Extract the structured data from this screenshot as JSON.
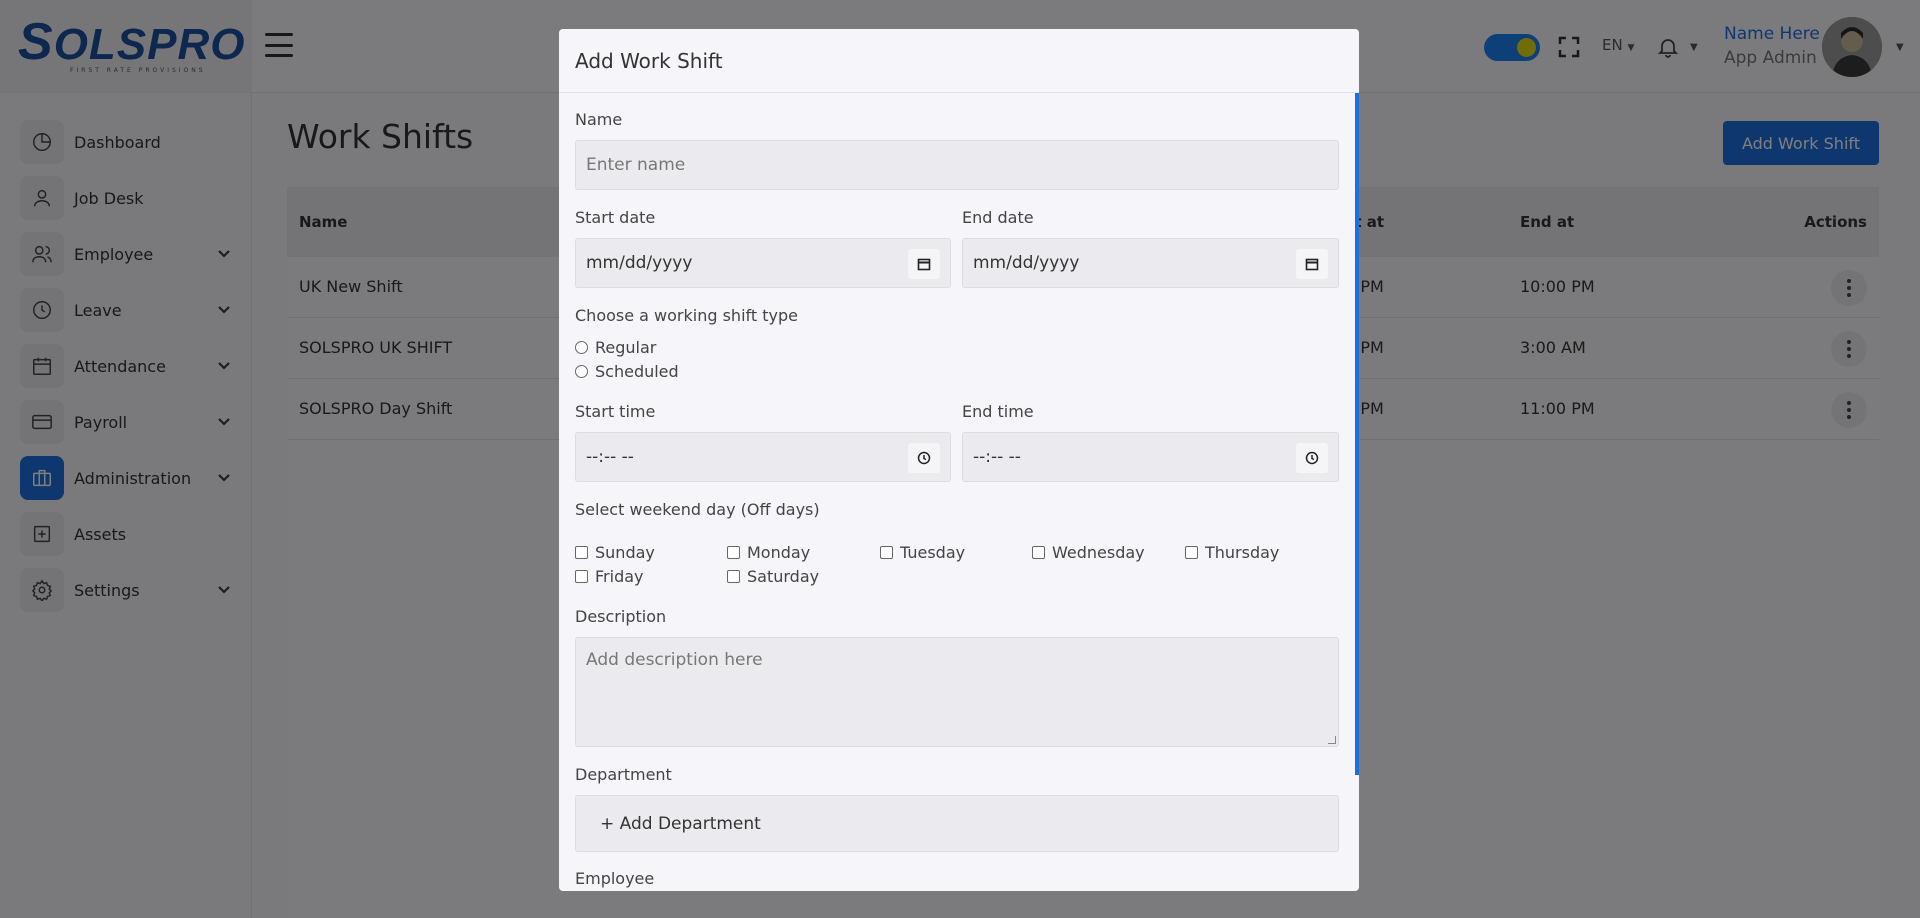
{
  "header": {
    "logo_text": "OLSPRO",
    "logo_tagline": "FIRST RATE PROVISIONS",
    "language": "EN",
    "user_name": "Name Here",
    "user_role": "App Admin"
  },
  "sidebar": {
    "items": [
      {
        "label": "Dashboard",
        "icon": "dashboard-icon",
        "chevron": false,
        "active": false
      },
      {
        "label": "Job Desk",
        "icon": "user-icon",
        "chevron": false,
        "active": false
      },
      {
        "label": "Employee",
        "icon": "users-icon",
        "chevron": true,
        "active": false
      },
      {
        "label": "Leave",
        "icon": "clock-icon",
        "chevron": true,
        "active": false
      },
      {
        "label": "Attendance",
        "icon": "calendar-icon",
        "chevron": true,
        "active": false
      },
      {
        "label": "Payroll",
        "icon": "credit-card-icon",
        "chevron": true,
        "active": false
      },
      {
        "label": "Administration",
        "icon": "briefcase-icon",
        "chevron": true,
        "active": true
      },
      {
        "label": "Assets",
        "icon": "plus-square-icon",
        "chevron": false,
        "active": false
      },
      {
        "label": "Settings",
        "icon": "gear-icon",
        "chevron": true,
        "active": false
      }
    ]
  },
  "page": {
    "title": "Work Shifts",
    "add_button": "Add Work Shift"
  },
  "table": {
    "columns": {
      "name": "Name",
      "start_at": "rt at",
      "end_at": "End at",
      "actions": "Actions"
    },
    "rows": [
      {
        "name": "UK New Shift",
        "start_at": ") PM",
        "end_at": "10:00 PM"
      },
      {
        "name": "SOLSPRO UK SHIFT",
        "start_at": ") PM",
        "end_at": "3:00 AM"
      },
      {
        "name": "SOLSPRO Day Shift",
        "start_at": ") PM",
        "end_at": "11:00 PM"
      }
    ]
  },
  "modal": {
    "title": "Add Work Shift",
    "name_label": "Name",
    "name_placeholder": "Enter name",
    "start_date_label": "Start date",
    "start_date_value": "mm/dd/yyyy",
    "end_date_label": "End date",
    "end_date_value": "mm/dd/yyyy",
    "shift_type_label": "Choose a working shift type",
    "shift_types": [
      "Regular",
      "Scheduled"
    ],
    "start_time_label": "Start time",
    "start_time_value": "--:-- --",
    "end_time_label": "End time",
    "end_time_value": "--:-- --",
    "weekend_label": "Select weekend day (Off days)",
    "weekdays": [
      "Sunday",
      "Monday",
      "Tuesday",
      "Wednesday",
      "Thursday",
      "Friday",
      "Saturday"
    ],
    "description_label": "Description",
    "description_placeholder": "Add description here",
    "department_label": "Department",
    "add_department": "+ Add Department",
    "employee_label": "Employee"
  },
  "colors": {
    "accent": "#1c6fde",
    "overlay": "rgba(0,0,0,0.5)",
    "toggle_knob": "#e5d80f"
  }
}
